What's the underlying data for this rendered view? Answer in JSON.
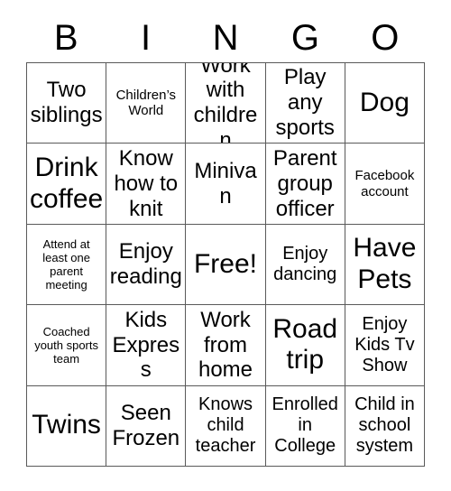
{
  "card": {
    "header_letters": [
      "B",
      "I",
      "N",
      "G",
      "O"
    ],
    "colors": {
      "background": "#ffffff",
      "text": "#000000",
      "gridline": "#5a5a5a"
    },
    "rows": [
      [
        {
          "text": "Two siblings",
          "size": "lg"
        },
        {
          "text": "Children’s World",
          "size": "sm"
        },
        {
          "text": "Work with children",
          "size": "lg"
        },
        {
          "text": "Play any sports",
          "size": "lg"
        },
        {
          "text": "Dog",
          "size": "xl"
        }
      ],
      [
        {
          "text": "Drink coffee",
          "size": "xl"
        },
        {
          "text": "Know how to knit",
          "size": "lg"
        },
        {
          "text": "Minivan",
          "size": "lg"
        },
        {
          "text": "Parent group officer",
          "size": "lg"
        },
        {
          "text": "Facebook account",
          "size": "sm"
        }
      ],
      [
        {
          "text": "Attend at least one parent meeting",
          "size": "xs"
        },
        {
          "text": "Enjoy reading",
          "size": "lg"
        },
        {
          "text": "Free!",
          "size": "xl"
        },
        {
          "text": "Enjoy dancing",
          "size": "md"
        },
        {
          "text": "Have Pets",
          "size": "xl"
        }
      ],
      [
        {
          "text": "Coached youth sports team",
          "size": "xs"
        },
        {
          "text": "Kids Express",
          "size": "lg"
        },
        {
          "text": "Work from home",
          "size": "lg"
        },
        {
          "text": "Road trip",
          "size": "xl"
        },
        {
          "text": "Enjoy Kids Tv Show",
          "size": "md"
        }
      ],
      [
        {
          "text": "Twins",
          "size": "xl"
        },
        {
          "text": "Seen Frozen",
          "size": "lg"
        },
        {
          "text": "Knows child teacher",
          "size": "md"
        },
        {
          "text": "Enrolled in College",
          "size": "md"
        },
        {
          "text": "Child in school system",
          "size": "md"
        }
      ]
    ]
  }
}
